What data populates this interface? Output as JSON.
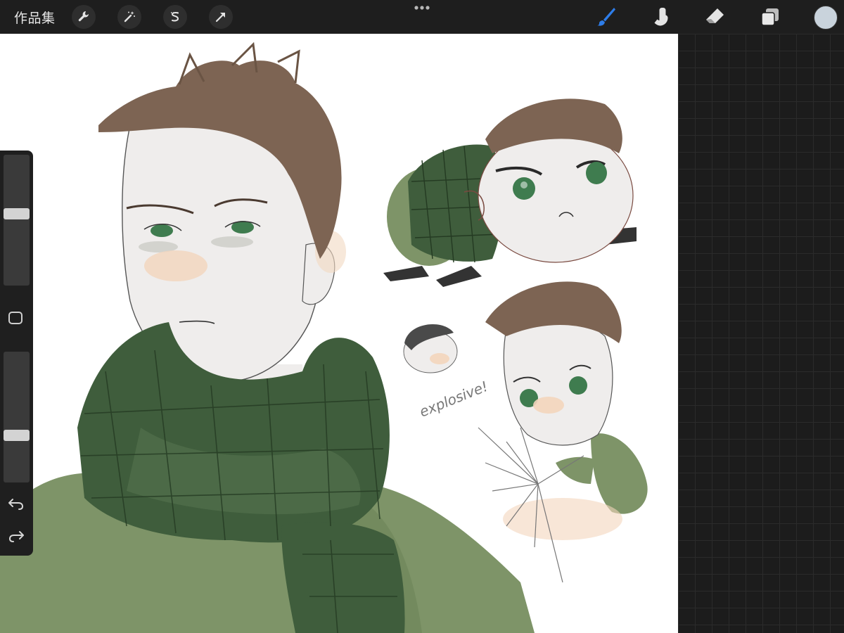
{
  "topbar": {
    "gallery_label": "作品集",
    "left_tools": [
      {
        "name": "actions",
        "icon": "wrench-icon"
      },
      {
        "name": "adjustments",
        "icon": "magic-wand-icon"
      },
      {
        "name": "selection",
        "icon": "selection-s-icon"
      },
      {
        "name": "transform",
        "icon": "arrow-cursor-icon"
      }
    ],
    "right_tools": [
      {
        "name": "brush",
        "icon": "brush-icon",
        "active": true
      },
      {
        "name": "smudge",
        "icon": "smudge-finger-icon"
      },
      {
        "name": "eraser",
        "icon": "eraser-icon"
      },
      {
        "name": "layers",
        "icon": "layers-icon"
      }
    ],
    "current_color": "#c9d3dc",
    "active_color": "#2e7de9"
  },
  "sidebar": {
    "brush_size_level": 0.55,
    "opacity_level": 0.35,
    "buttons": [
      {
        "name": "modify",
        "icon": "square-outline-icon"
      },
      {
        "name": "undo",
        "icon": "undo-icon"
      },
      {
        "name": "redo",
        "icon": "redo-icon"
      }
    ]
  },
  "canvas": {
    "annotation_text": "explosive!"
  },
  "colors": {
    "scarf_green": "#3f5d3c",
    "jacket_green": "#7e9468",
    "hair_brown": "#7d6453",
    "skin": "#efedec",
    "eye_green": "#3f7c4f"
  }
}
